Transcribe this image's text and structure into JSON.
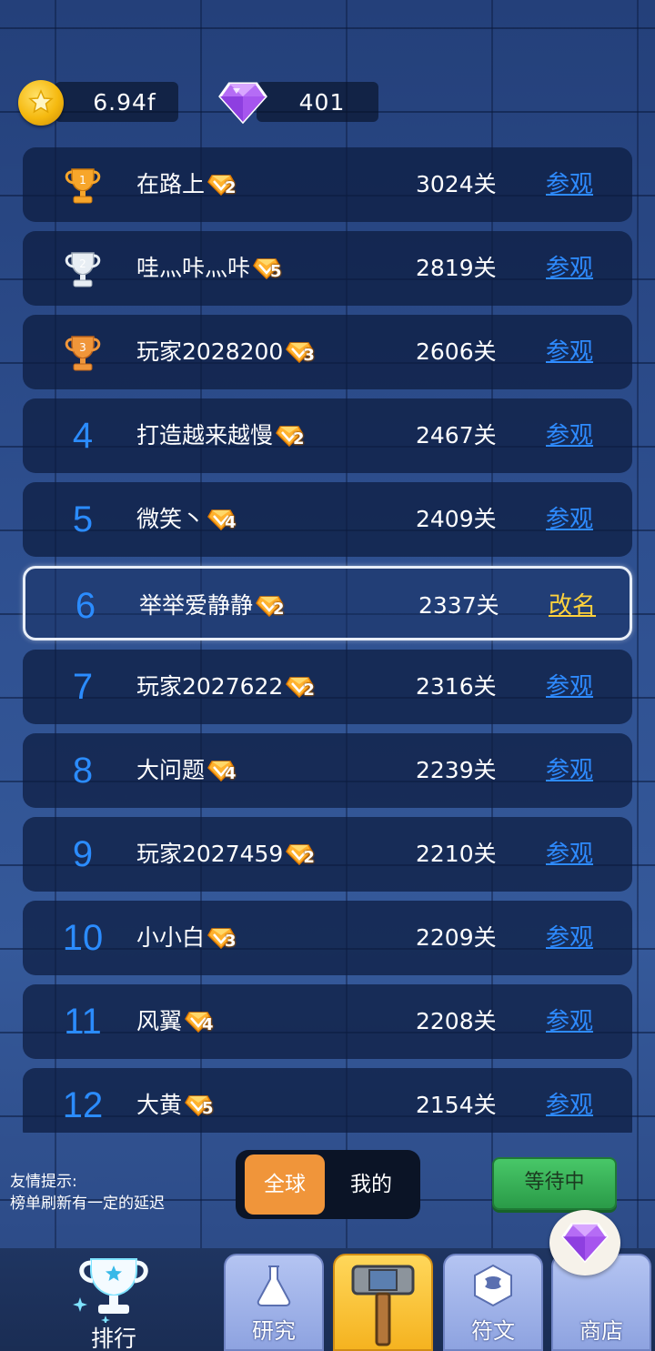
{
  "currency": {
    "gold": "6.94f",
    "gems": "401"
  },
  "rankings": [
    {
      "rank": "1",
      "name": "在路上",
      "vip": "2",
      "level": "3024关",
      "action": "参观",
      "trophy": "gold"
    },
    {
      "rank": "2",
      "name": "哇灬咔灬咔",
      "vip": "5",
      "level": "2819关",
      "action": "参观",
      "trophy": "silver"
    },
    {
      "rank": "3",
      "name": "玩家2028200",
      "vip": "3",
      "level": "2606关",
      "action": "参观",
      "trophy": "bronze"
    },
    {
      "rank": "4",
      "name": "打造越来越慢",
      "vip": "2",
      "level": "2467关",
      "action": "参观"
    },
    {
      "rank": "5",
      "name": "微笑丶",
      "vip": "4",
      "level": "2409关",
      "action": "参观"
    },
    {
      "rank": "6",
      "name": "举举爱静静",
      "vip": "2",
      "level": "2337关",
      "action": "改名",
      "is_me": true
    },
    {
      "rank": "7",
      "name": "玩家2027622",
      "vip": "2",
      "level": "2316关",
      "action": "参观"
    },
    {
      "rank": "8",
      "name": "大问题",
      "vip": "4",
      "level": "2239关",
      "action": "参观"
    },
    {
      "rank": "9",
      "name": "玩家2027459",
      "vip": "2",
      "level": "2210关",
      "action": "参观"
    },
    {
      "rank": "10",
      "name": "小小白",
      "vip": "3",
      "level": "2209关",
      "action": "参观"
    },
    {
      "rank": "11",
      "name": "风翼",
      "vip": "4",
      "level": "2208关",
      "action": "参观"
    },
    {
      "rank": "12",
      "name": "大黄",
      "vip": "5",
      "level": "2154关",
      "action": "参观"
    }
  ],
  "tip": {
    "line1": "友情提示:",
    "line2": "榜单刷新有一定的延迟"
  },
  "scope_toggle": {
    "global": "全球",
    "mine": "我的",
    "selected": "全球"
  },
  "status_button": "等待中",
  "nav": {
    "rank": "排行",
    "research": "研究",
    "rune": "符文",
    "shop": "商店"
  },
  "colors": {
    "rank_number": "#2b8cff",
    "link": "#2e8bff",
    "rename": "#ffd23c",
    "toggle_active": "#f0953a",
    "status_button": "#3bb55a"
  }
}
